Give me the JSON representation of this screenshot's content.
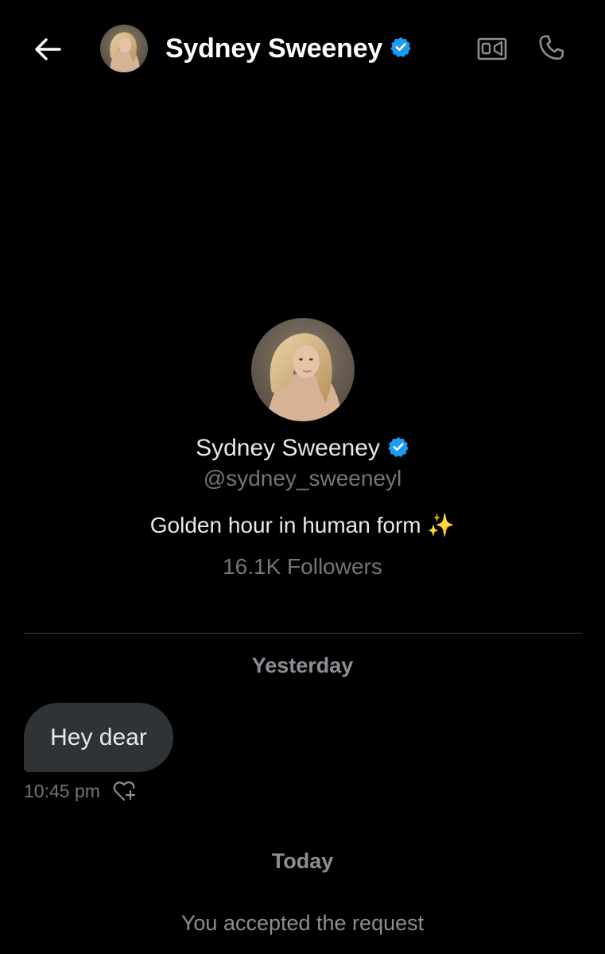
{
  "header": {
    "name": "Sydney Sweeney",
    "back_icon": "arrow-left-icon",
    "video_icon": "video-call-icon",
    "call_icon": "phone-call-icon"
  },
  "profile": {
    "name": "Sydney Sweeney",
    "handle": "@sydney_sweeneyl",
    "bio": "Golden hour in human form ✨",
    "followers": "16.1K Followers",
    "verified_color": "#1d9bf0"
  },
  "conversation": {
    "day_1": "Yesterday",
    "messages": [
      {
        "text": "Hey dear",
        "time": "10:45 pm"
      }
    ],
    "day_2": "Today",
    "system_note": "You accepted the request"
  },
  "colors": {
    "background": "#000000",
    "bubble": "#2f3336",
    "muted_text": "#71767b",
    "accent": "#1d9bf0"
  }
}
